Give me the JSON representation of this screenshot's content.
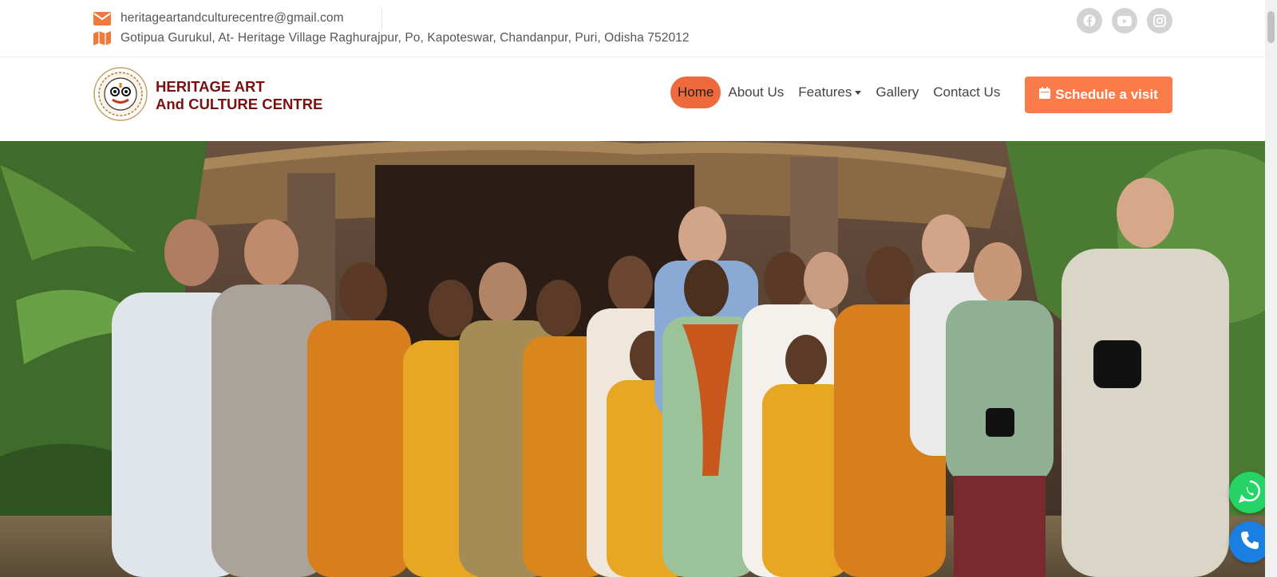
{
  "topbar": {
    "email": "heritageartandculturecentre@gmail.com",
    "address": "Gotipua Gurukul, At- Heritage Village Raghurajpur, Po, Kapoteswar, Chandanpur, Puri, Odisha 752012",
    "email_icon": "envelope-icon",
    "address_icon": "map-icon",
    "icon_color": "#f07a3c"
  },
  "social": [
    {
      "icon": "facebook-icon"
    },
    {
      "icon": "youtube-icon"
    },
    {
      "icon": "instagram-icon"
    }
  ],
  "brand": {
    "line1": "HERITAGE ART",
    "line2": "And CULTURE CENTRE",
    "color": "#7a1010"
  },
  "nav": {
    "items": [
      {
        "label": "Home",
        "active": true
      },
      {
        "label": "About Us"
      },
      {
        "label": "Features",
        "dropdown": true
      },
      {
        "label": "Gallery"
      },
      {
        "label": "Contact Us"
      }
    ],
    "active_color": "#ee6a3d"
  },
  "cta": {
    "label": "Schedule a visit",
    "icon": "calendar-icon",
    "color": "#fb7b4a"
  },
  "hero": {
    "image": "group-photo-performers-and-visitors"
  },
  "floating": {
    "whatsapp_icon": "whatsapp-icon",
    "call_icon": "phone-icon"
  }
}
